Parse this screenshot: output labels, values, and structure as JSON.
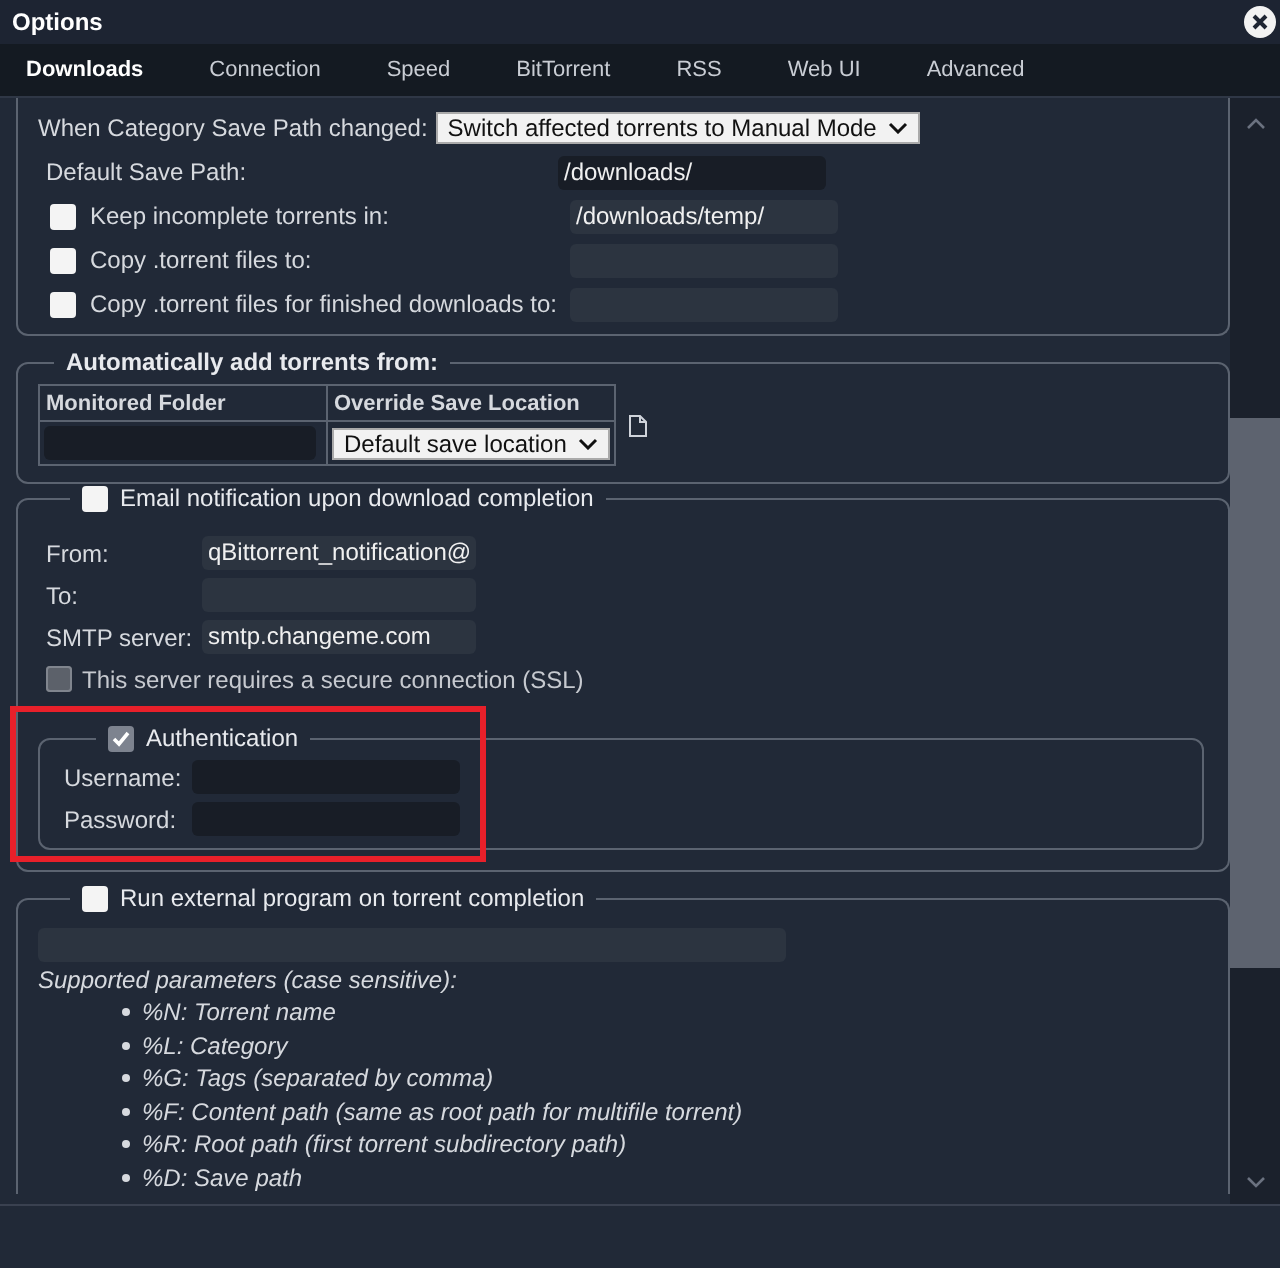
{
  "window": {
    "title": "Options"
  },
  "tabs": [
    {
      "label": "Downloads",
      "selected": true
    },
    {
      "label": "Connection",
      "selected": false
    },
    {
      "label": "Speed",
      "selected": false
    },
    {
      "label": "BitTorrent",
      "selected": false
    },
    {
      "label": "RSS",
      "selected": false
    },
    {
      "label": "Web UI",
      "selected": false
    },
    {
      "label": "Advanced",
      "selected": false
    }
  ],
  "save_paths": {
    "category_change": {
      "label": "When Category Save Path changed:",
      "value": "Switch affected torrents to Manual Mode"
    },
    "rows": [
      {
        "kind": "plain",
        "label": "Default Save Path:",
        "value": "/downloads/"
      },
      {
        "kind": "checkbox",
        "checked": false,
        "label": "Keep incomplete torrents in:",
        "value": "/downloads/temp/"
      },
      {
        "kind": "checkbox",
        "checked": false,
        "label": "Copy .torrent files to:"
      },
      {
        "kind": "checkbox",
        "checked": false,
        "label": "Copy .torrent files for finished downloads to:"
      }
    ]
  },
  "auto_add": {
    "title": "Automatically add torrents from:",
    "columns": [
      "Monitored Folder",
      "Override Save Location"
    ],
    "rows": [
      {
        "location": "Default save location"
      }
    ]
  },
  "email": {
    "checked": false,
    "title": "Email notification upon download completion",
    "fields": [
      {
        "label": "From:",
        "value": "qBittorrent_notification@"
      },
      {
        "label": "To:"
      },
      {
        "label": "SMTP server:",
        "value": "smtp.changeme.com"
      }
    ],
    "ssl": {
      "label": "This server requires a secure connection (SSL)",
      "checked": false,
      "disabled": true
    },
    "auth": {
      "checked": true,
      "highlighted": true,
      "title": "Authentication",
      "fields": [
        {
          "label": "Username:"
        },
        {
          "label": "Password:"
        }
      ]
    }
  },
  "run_program": {
    "checked": false,
    "title": "Run external program on torrent completion",
    "heading": "Supported parameters (case sensitive):",
    "params": [
      "%N: Torrent name",
      "%L: Category",
      "%G: Tags (separated by comma)",
      "%F: Content path (same as root path for multifile torrent)",
      "%R: Root path (first torrent subdirectory path)",
      "%D: Save path"
    ]
  }
}
